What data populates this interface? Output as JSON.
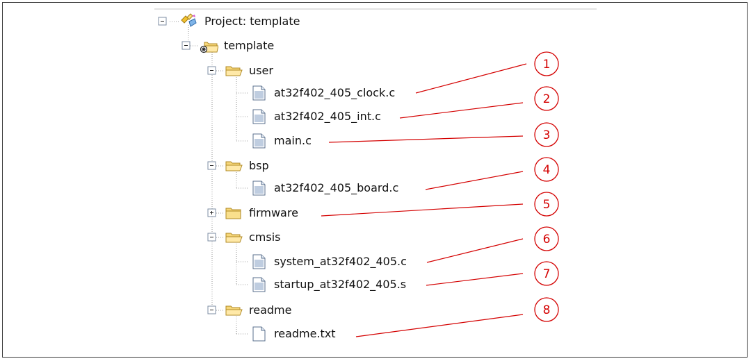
{
  "tree": {
    "project_label": "Project: template",
    "target_label": "template",
    "groups": [
      {
        "label": "user",
        "expanded": true,
        "files": [
          "at32f402_405_clock.c",
          "at32f402_405_int.c",
          "main.c"
        ]
      },
      {
        "label": "bsp",
        "expanded": true,
        "files": [
          "at32f402_405_board.c"
        ]
      },
      {
        "label": "firmware",
        "expanded": false,
        "files": []
      },
      {
        "label": "cmsis",
        "expanded": true,
        "files": [
          "system_at32f402_405.c",
          "startup_at32f402_405.s"
        ]
      },
      {
        "label": "readme",
        "expanded": true,
        "files": [
          "readme.txt"
        ]
      }
    ]
  },
  "callouts": [
    "1",
    "2",
    "3",
    "4",
    "5",
    "6",
    "7",
    "8"
  ],
  "colors": {
    "callout": "#d40000",
    "folder_fill": "#f6d77a",
    "folder_stroke": "#b08a24",
    "dotted_line": "#9a9a9a"
  },
  "icons": {
    "project": "project-icon",
    "target": "target-icon",
    "folder": "folder-icon",
    "file": "file-icon",
    "text_file": "text-file-icon",
    "expand": "plus-box-icon",
    "collapse": "minus-box-icon"
  }
}
